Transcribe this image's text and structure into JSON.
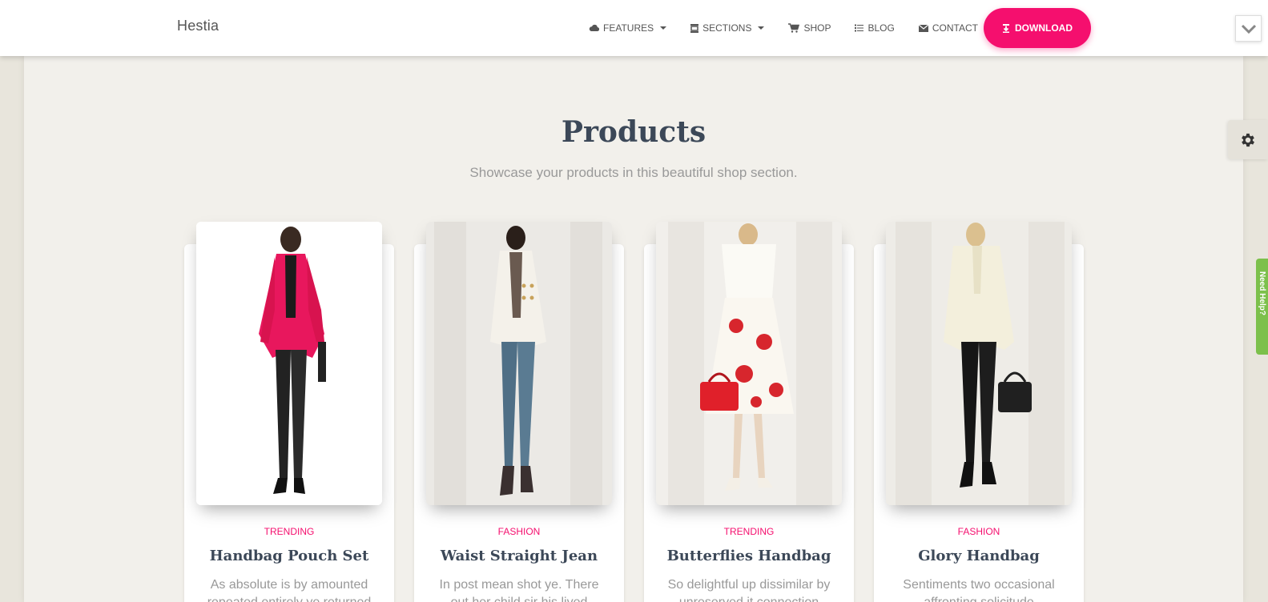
{
  "brand": "Hestia",
  "nav": {
    "items": [
      {
        "label": "FEATURES",
        "icon": "cloud-icon",
        "dropdown": true
      },
      {
        "label": "SECTIONS",
        "icon": "layout-icon",
        "dropdown": true
      },
      {
        "label": "SHOP",
        "icon": "cart-icon",
        "dropdown": false
      },
      {
        "label": "BLOG",
        "icon": "list-icon",
        "dropdown": false
      },
      {
        "label": "CONTACT",
        "icon": "envelope-icon",
        "dropdown": false
      }
    ],
    "download_label": "DOWNLOAD"
  },
  "section": {
    "title": "Products",
    "subtitle": "Showcase your products in this beautiful shop section."
  },
  "products": [
    {
      "category": "TRENDING",
      "title": "Handbag Pouch Set",
      "description": "As absolute is by amounted repeated entirely ye returned"
    },
    {
      "category": "FASHION",
      "title": "Waist Straight Jean",
      "description": "In post mean shot ye. There out her child sir his lived"
    },
    {
      "category": "TRENDING",
      "title": "Butterflies Handbag",
      "description": "So delightful up dissimilar by unreserved it connection"
    },
    {
      "category": "FASHION",
      "title": "Glory Handbag",
      "description": "Sentiments two occasional affronting solicitude"
    }
  ],
  "help_tab": "Need Help?",
  "colors": {
    "accent": "#f50f6e",
    "page_bg": "#e8e5dc",
    "section_bg": "#f2f0eb",
    "heading": "#3c4858",
    "muted": "#999999",
    "help_green": "#7cc04b"
  }
}
